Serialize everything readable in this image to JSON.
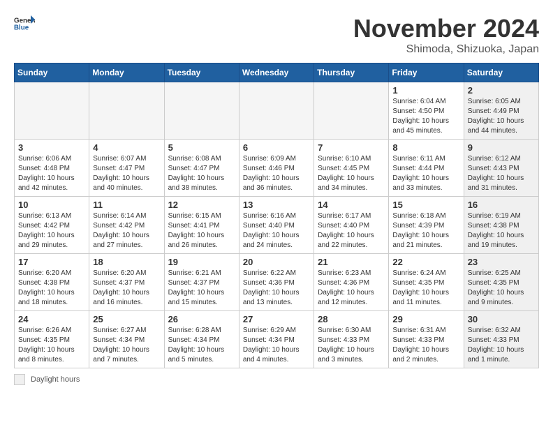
{
  "logo": {
    "general": "General",
    "blue": "Blue"
  },
  "title": "November 2024",
  "location": "Shimoda, Shizuoka, Japan",
  "days_of_week": [
    "Sunday",
    "Monday",
    "Tuesday",
    "Wednesday",
    "Thursday",
    "Friday",
    "Saturday"
  ],
  "legend_label": "Daylight hours",
  "weeks": [
    [
      {
        "day": "",
        "info": "",
        "empty": true
      },
      {
        "day": "",
        "info": "",
        "empty": true
      },
      {
        "day": "",
        "info": "",
        "empty": true
      },
      {
        "day": "",
        "info": "",
        "empty": true
      },
      {
        "day": "",
        "info": "",
        "empty": true
      },
      {
        "day": "1",
        "info": "Sunrise: 6:04 AM\nSunset: 4:50 PM\nDaylight: 10 hours\nand 45 minutes.",
        "shaded": false
      },
      {
        "day": "2",
        "info": "Sunrise: 6:05 AM\nSunset: 4:49 PM\nDaylight: 10 hours\nand 44 minutes.",
        "shaded": true
      }
    ],
    [
      {
        "day": "3",
        "info": "Sunrise: 6:06 AM\nSunset: 4:48 PM\nDaylight: 10 hours\nand 42 minutes.",
        "shaded": false
      },
      {
        "day": "4",
        "info": "Sunrise: 6:07 AM\nSunset: 4:47 PM\nDaylight: 10 hours\nand 40 minutes.",
        "shaded": false
      },
      {
        "day": "5",
        "info": "Sunrise: 6:08 AM\nSunset: 4:47 PM\nDaylight: 10 hours\nand 38 minutes.",
        "shaded": false
      },
      {
        "day": "6",
        "info": "Sunrise: 6:09 AM\nSunset: 4:46 PM\nDaylight: 10 hours\nand 36 minutes.",
        "shaded": false
      },
      {
        "day": "7",
        "info": "Sunrise: 6:10 AM\nSunset: 4:45 PM\nDaylight: 10 hours\nand 34 minutes.",
        "shaded": false
      },
      {
        "day": "8",
        "info": "Sunrise: 6:11 AM\nSunset: 4:44 PM\nDaylight: 10 hours\nand 33 minutes.",
        "shaded": false
      },
      {
        "day": "9",
        "info": "Sunrise: 6:12 AM\nSunset: 4:43 PM\nDaylight: 10 hours\nand 31 minutes.",
        "shaded": true
      }
    ],
    [
      {
        "day": "10",
        "info": "Sunrise: 6:13 AM\nSunset: 4:42 PM\nDaylight: 10 hours\nand 29 minutes.",
        "shaded": false
      },
      {
        "day": "11",
        "info": "Sunrise: 6:14 AM\nSunset: 4:42 PM\nDaylight: 10 hours\nand 27 minutes.",
        "shaded": false
      },
      {
        "day": "12",
        "info": "Sunrise: 6:15 AM\nSunset: 4:41 PM\nDaylight: 10 hours\nand 26 minutes.",
        "shaded": false
      },
      {
        "day": "13",
        "info": "Sunrise: 6:16 AM\nSunset: 4:40 PM\nDaylight: 10 hours\nand 24 minutes.",
        "shaded": false
      },
      {
        "day": "14",
        "info": "Sunrise: 6:17 AM\nSunset: 4:40 PM\nDaylight: 10 hours\nand 22 minutes.",
        "shaded": false
      },
      {
        "day": "15",
        "info": "Sunrise: 6:18 AM\nSunset: 4:39 PM\nDaylight: 10 hours\nand 21 minutes.",
        "shaded": false
      },
      {
        "day": "16",
        "info": "Sunrise: 6:19 AM\nSunset: 4:38 PM\nDaylight: 10 hours\nand 19 minutes.",
        "shaded": true
      }
    ],
    [
      {
        "day": "17",
        "info": "Sunrise: 6:20 AM\nSunset: 4:38 PM\nDaylight: 10 hours\nand 18 minutes.",
        "shaded": false
      },
      {
        "day": "18",
        "info": "Sunrise: 6:20 AM\nSunset: 4:37 PM\nDaylight: 10 hours\nand 16 minutes.",
        "shaded": false
      },
      {
        "day": "19",
        "info": "Sunrise: 6:21 AM\nSunset: 4:37 PM\nDaylight: 10 hours\nand 15 minutes.",
        "shaded": false
      },
      {
        "day": "20",
        "info": "Sunrise: 6:22 AM\nSunset: 4:36 PM\nDaylight: 10 hours\nand 13 minutes.",
        "shaded": false
      },
      {
        "day": "21",
        "info": "Sunrise: 6:23 AM\nSunset: 4:36 PM\nDaylight: 10 hours\nand 12 minutes.",
        "shaded": false
      },
      {
        "day": "22",
        "info": "Sunrise: 6:24 AM\nSunset: 4:35 PM\nDaylight: 10 hours\nand 11 minutes.",
        "shaded": false
      },
      {
        "day": "23",
        "info": "Sunrise: 6:25 AM\nSunset: 4:35 PM\nDaylight: 10 hours\nand 9 minutes.",
        "shaded": true
      }
    ],
    [
      {
        "day": "24",
        "info": "Sunrise: 6:26 AM\nSunset: 4:35 PM\nDaylight: 10 hours\nand 8 minutes.",
        "shaded": false
      },
      {
        "day": "25",
        "info": "Sunrise: 6:27 AM\nSunset: 4:34 PM\nDaylight: 10 hours\nand 7 minutes.",
        "shaded": false
      },
      {
        "day": "26",
        "info": "Sunrise: 6:28 AM\nSunset: 4:34 PM\nDaylight: 10 hours\nand 5 minutes.",
        "shaded": false
      },
      {
        "day": "27",
        "info": "Sunrise: 6:29 AM\nSunset: 4:34 PM\nDaylight: 10 hours\nand 4 minutes.",
        "shaded": false
      },
      {
        "day": "28",
        "info": "Sunrise: 6:30 AM\nSunset: 4:33 PM\nDaylight: 10 hours\nand 3 minutes.",
        "shaded": false
      },
      {
        "day": "29",
        "info": "Sunrise: 6:31 AM\nSunset: 4:33 PM\nDaylight: 10 hours\nand 2 minutes.",
        "shaded": false
      },
      {
        "day": "30",
        "info": "Sunrise: 6:32 AM\nSunset: 4:33 PM\nDaylight: 10 hours\nand 1 minute.",
        "shaded": true
      }
    ]
  ]
}
